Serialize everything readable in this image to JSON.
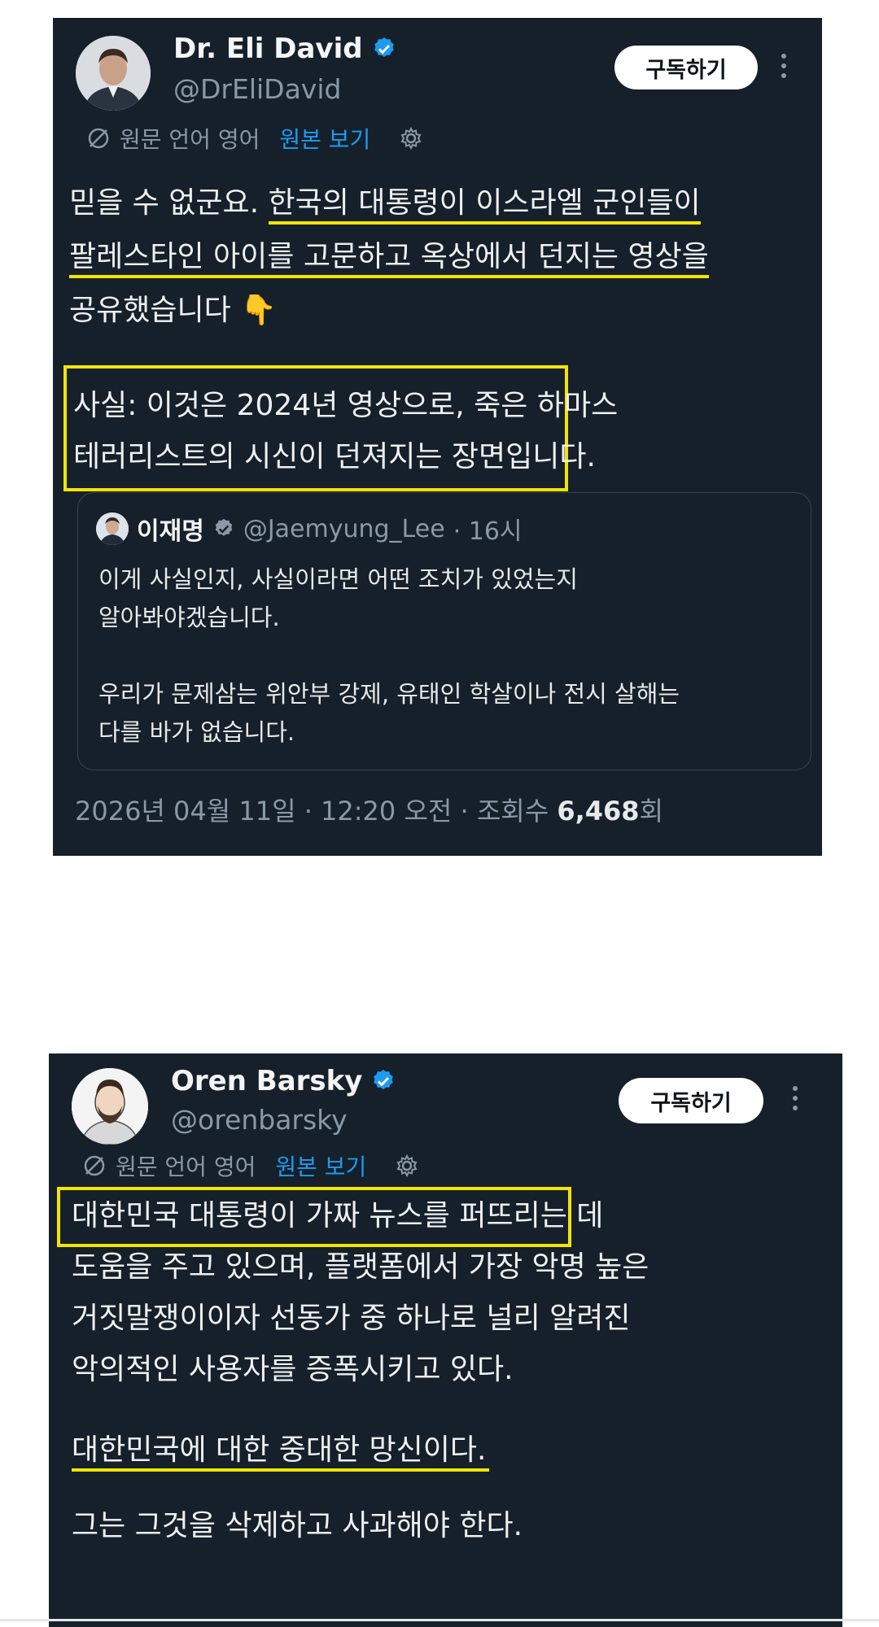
{
  "tweet1": {
    "author_name": "Dr. Eli David",
    "author_handle": "@DrEliDavid",
    "subscribe_label": "구독하기",
    "translate_note": "원문 언어 영어",
    "view_original_label": "원본 보기",
    "body_lines": [
      "믿을 수 없군요. 한국의 대통령이 이스라엘 군인들이",
      "팔레스타인 아이를 고문하고 옥상에서 던지는 영상을",
      "공유했습니다 👇"
    ],
    "line1_plain": "믿을 수 없군요. ",
    "line1_underlined": "한국의 대통령이 이스라엘 군인들이",
    "line2": "팔레스타인 아이를 고문하고 옥상에서 던지는 영상을",
    "line3": "공유했습니다 👇",
    "fact_lines": [
      "사실: 이것은 2024년 영상으로, 죽은 하마스",
      "테러리스트의 시신이 던져지는 장면입니다."
    ],
    "quote": {
      "name": "이재명",
      "handle": "@Jaemyung_Lee",
      "time": "· 16시",
      "lines": [
        "이게 사실인지, 사실이라면 어떤 조치가 있었는지",
        "알아봐야겠습니다.",
        "우리가 문제삼는 위안부 강제, 유태인 학살이나 전시 살해는",
        "다를 바가 없습니다."
      ]
    },
    "meta_prefix": "2026년 04월 11일 · 12:20 오전 · 조회수 ",
    "view_count": "6,468",
    "view_suffix": "회"
  },
  "tweet2": {
    "author_name": "Oren Barsky",
    "author_handle": "@orenbarsky",
    "subscribe_label": "구독하기",
    "translate_note": "원문 언어 영어",
    "view_original_label": "원본 보기",
    "body_lines": [
      "대한민국 대통령이 가짜 뉴스를 퍼뜨리는 데",
      "도움을 주고 있으며, 플랫폼에서 가장 악명 높은",
      "거짓말쟁이이자 선동가 중 하나로 널리 알려진",
      "악의적인 사용자를 증폭시키고 있다.",
      "대한민국에 대한 중대한 망신이다.",
      "그는 그것을 삭제하고 사과해야 한다."
    ]
  },
  "colors": {
    "card_bg": "#15202b",
    "highlight": "#f3e500",
    "link": "#1d9bf0",
    "verified": "#1d9bf0"
  },
  "icons": [
    "verified-badge-icon",
    "more-options-icon",
    "translate-icon",
    "settings-gear-icon"
  ]
}
